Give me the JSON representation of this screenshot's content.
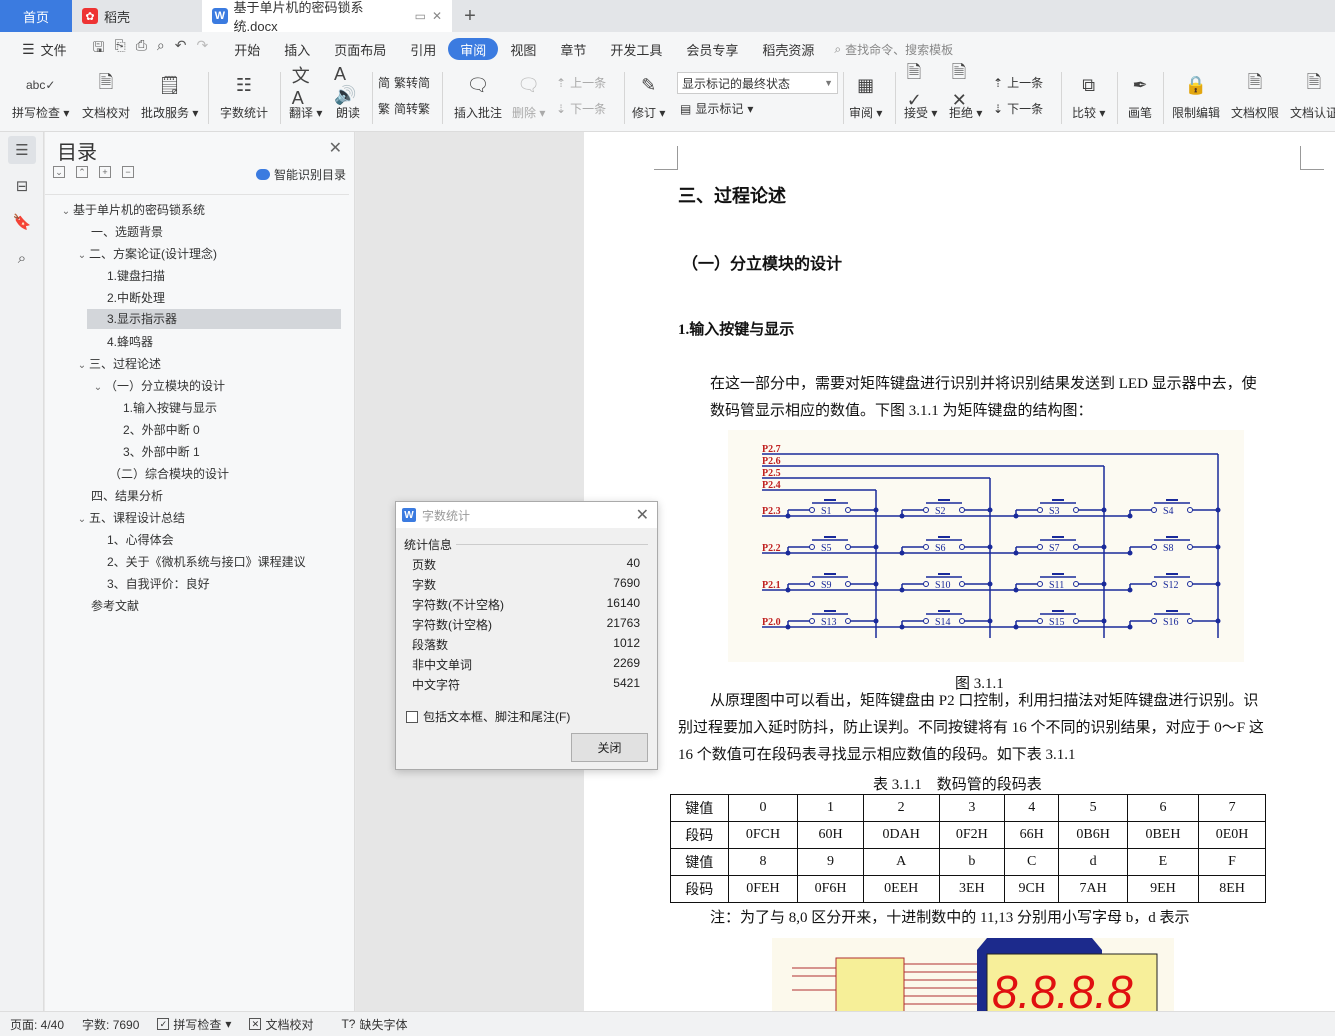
{
  "tabs": {
    "home": "首页",
    "daoke": "稻壳",
    "doc": "基于单片机的密码锁系统.docx"
  },
  "menu": {
    "file": "文件",
    "items": [
      "开始",
      "插入",
      "页面布局",
      "引用",
      "审阅",
      "视图",
      "章节",
      "开发工具",
      "会员专享",
      "稻壳资源"
    ],
    "search": "查找命令、搜索模板"
  },
  "ribbon": {
    "spellcheck": "拼写检查",
    "doccheck": "文档校对",
    "annotate_service": "批改服务",
    "wordcount": "字数统计",
    "translate": "翻译",
    "read": "朗读",
    "trad": "繁转简",
    "simp": "简转繁",
    "insert_comment": "插入批注",
    "delete": "删除",
    "prev_comment": "上一条",
    "next_comment": "下一条",
    "revise": "修订",
    "markup_combo": "显示标记的最终状态",
    "show_markup": "显示标记",
    "review": "审阅",
    "accept": "接受",
    "reject": "拒绝",
    "prev": "上一条",
    "next": "下一条",
    "compare": "比较",
    "pen": "画笔",
    "restrict": "限制编辑",
    "perm": "文档权限",
    "cert": "文档认证"
  },
  "toc": {
    "title": "目录",
    "smart": "智能识别目录",
    "items": [
      {
        "label": "基于单片机的密码锁系统"
      },
      {
        "label": "一、选题背景"
      },
      {
        "label": "二、方案论证(设计理念)"
      },
      {
        "label": "1.键盘扫描"
      },
      {
        "label": "2.中断处理"
      },
      {
        "label": "3.显示指示器"
      },
      {
        "label": "4.蜂鸣器"
      },
      {
        "label": "三、过程论述"
      },
      {
        "label": "（一）分立模块的设计"
      },
      {
        "label": "1.输入按键与显示"
      },
      {
        "label": "2、外部中断 0"
      },
      {
        "label": "3、外部中断 1"
      },
      {
        "label": "（二）综合模块的设计"
      },
      {
        "label": "四、结果分析"
      },
      {
        "label": "五、课程设计总结"
      },
      {
        "label": "1、心得体会"
      },
      {
        "label": "2、关于《微机系统与接口》课程建议"
      },
      {
        "label": "3、自我评价：良好"
      },
      {
        "label": "参考文献"
      }
    ]
  },
  "doc": {
    "h1": "三、过程论述",
    "h2": "（一）分立模块的设计",
    "h3": "1.输入按键与显示",
    "p1_line1": "在这一部分中，需要对矩阵键盘进行识别并将识别结果发送到 LED 显示器中去，使",
    "p1_line2": "数码管显示相应的数值。下图 3.1.1 为矩阵键盘的结构图：",
    "fig_caption": "图 3.1.1",
    "p2_line1": "从原理图中可以看出，矩阵键盘由 P2 口控制，利用扫描法对矩阵键盘进行识别。识",
    "p2_line2": "别过程要加入延时防抖，防止误判。不同按键将有 16 个不同的识别结果，对应于 0～F 这",
    "p2_line3": "16 个数值可在段码表寻找显示相应数值的段码。如下表 3.1.1",
    "table_caption": "表 3.1.1　数码管的段码表",
    "table": [
      [
        "键值",
        "0",
        "1",
        "2",
        "3",
        "4",
        "5",
        "6",
        "7"
      ],
      [
        "段码",
        "0FCH",
        "60H",
        "0DAH",
        "0F2H",
        "66H",
        "0B6H",
        "0BEH",
        "0E0H"
      ],
      [
        "键值",
        "8",
        "9",
        "A",
        "b",
        "C",
        "d",
        "E",
        "F"
      ],
      [
        "段码",
        "0FEH",
        "0F6H",
        "0EEH",
        "3EH",
        "9CH",
        "7AH",
        "9EH",
        "8EH"
      ]
    ],
    "note": "注：为了与 8,0 区分开来，十进制数中的 11,13 分别用小写字母 b，d 表示",
    "circuit_rows": [
      "P2.3",
      "P2.2",
      "P2.1",
      "P2.0"
    ],
    "circuit_cols": [
      "P2.7",
      "P2.6",
      "P2.5",
      "P2.4"
    ],
    "switches": [
      "S1",
      "S2",
      "S3",
      "S4",
      "S5",
      "S6",
      "S7",
      "S8",
      "S9",
      "S10",
      "S11",
      "S12",
      "S13",
      "S14",
      "S15",
      "S16"
    ]
  },
  "dialog": {
    "title": "字数统计",
    "group": "统计信息",
    "stats": [
      {
        "label": "页数",
        "value": "40"
      },
      {
        "label": "字数",
        "value": "7690"
      },
      {
        "label": "字符数(不计空格)",
        "value": "16140"
      },
      {
        "label": "字符数(计空格)",
        "value": "21763"
      },
      {
        "label": "段落数",
        "value": "1012"
      },
      {
        "label": "非中文单词",
        "value": "2269"
      },
      {
        "label": "中文字符",
        "value": "5421"
      }
    ],
    "checkbox": "包括文本框、脚注和尾注(F)",
    "close": "关闭"
  },
  "status": {
    "page": "页面: 4/40",
    "words": "字数: 7690",
    "spell": "拼写检查",
    "check": "文档校对",
    "font": "缺失字体"
  }
}
